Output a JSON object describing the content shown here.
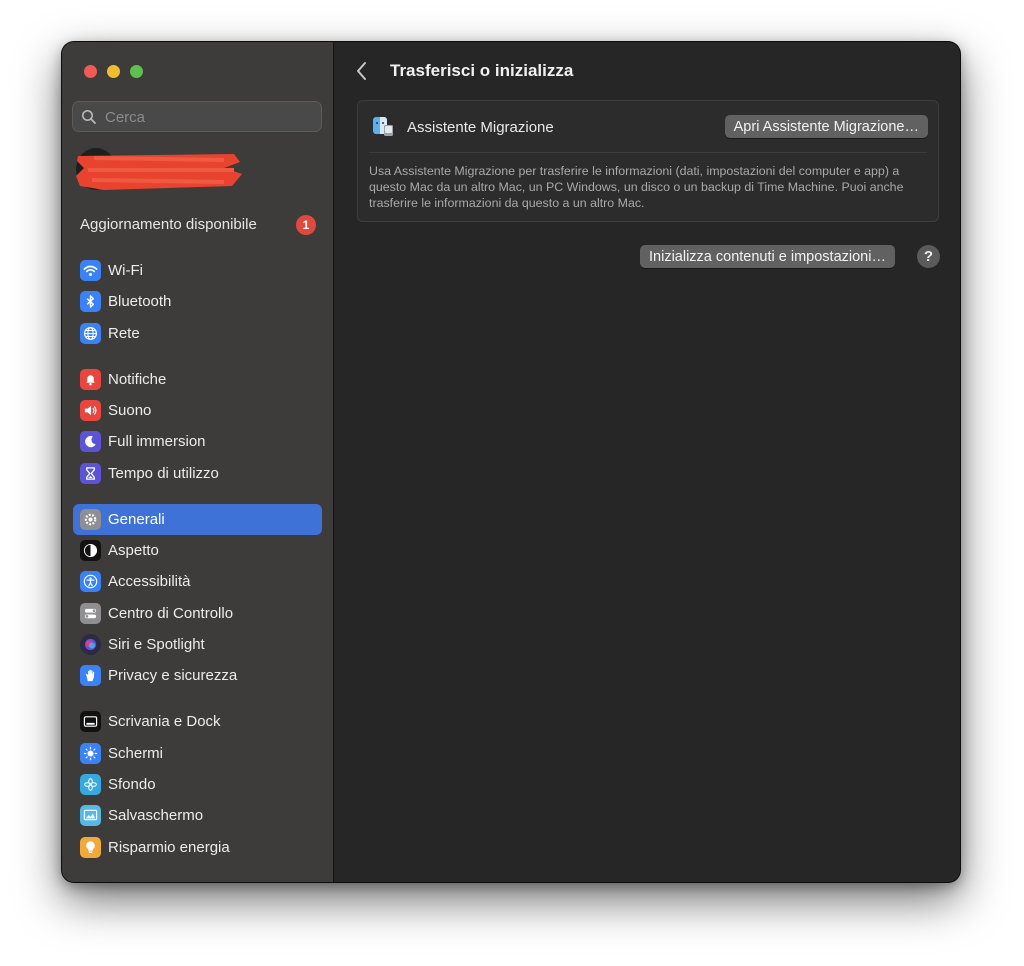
{
  "sidebar": {
    "search_placeholder": "Cerca",
    "update": {
      "label": "Aggiornamento disponibile",
      "badge": "1"
    },
    "items": [
      {
        "label": "Wi-Fi",
        "icon": "wifi-icon",
        "color": "#3a82f6"
      },
      {
        "label": "Bluetooth",
        "icon": "bluetooth-icon",
        "color": "#3a82f6"
      },
      {
        "label": "Rete",
        "icon": "globe-icon",
        "color": "#3a82f6"
      },
      {
        "label": "Notifiche",
        "icon": "bell-icon",
        "color": "#e8463f"
      },
      {
        "label": "Suono",
        "icon": "speaker-icon",
        "color": "#e8463f"
      },
      {
        "label": "Full immersion",
        "icon": "moon-icon",
        "color": "#5b55d6"
      },
      {
        "label": "Tempo di utilizzo",
        "icon": "hourglass-icon",
        "color": "#5b55d6"
      },
      {
        "label": "Generali",
        "icon": "gear-icon",
        "color": "#8e8e93",
        "active": true
      },
      {
        "label": "Aspetto",
        "icon": "appearance-icon",
        "color": "#111111"
      },
      {
        "label": "Accessibilità",
        "icon": "accessibility-icon",
        "color": "#3a82f6"
      },
      {
        "label": "Centro di Controllo",
        "icon": "toggles-icon",
        "color": "#8e8e93"
      },
      {
        "label": "Siri e Spotlight",
        "icon": "siri-icon",
        "color": "#2b2b44"
      },
      {
        "label": "Privacy e sicurezza",
        "icon": "hand-icon",
        "color": "#3a82f6"
      },
      {
        "label": "Scrivania e Dock",
        "icon": "dock-icon",
        "color": "#111111"
      },
      {
        "label": "Schermi",
        "icon": "sun-icon",
        "color": "#3a82f6"
      },
      {
        "label": "Sfondo",
        "icon": "flower-icon",
        "color": "#35a9e0"
      },
      {
        "label": "Salvaschermo",
        "icon": "screensaver-icon",
        "color": "#56b8e6"
      },
      {
        "label": "Risparmio energia",
        "icon": "lightbulb-icon",
        "color": "#f2a93b"
      }
    ]
  },
  "main": {
    "title": "Trasferisci o inizializza",
    "migration": {
      "label": "Assistente Migrazione",
      "button": "Apri Assistente Migrazione…",
      "description": "Usa Assistente Migrazione per trasferire le informazioni (dati, impostazioni del computer e app) a questo Mac da un altro Mac, un PC Windows, un disco o un backup di Time Machine. Puoi anche trasferire le informazioni da questo a un altro Mac."
    },
    "erase_button": "Inizializza contenuti e impostazioni…",
    "help_button": "?"
  }
}
